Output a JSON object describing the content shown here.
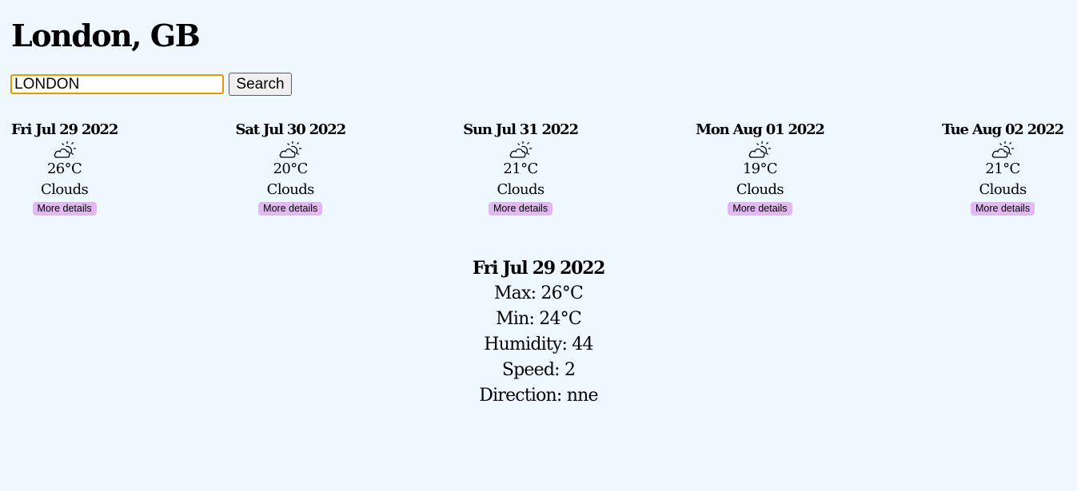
{
  "header": {
    "title": "London, GB"
  },
  "search": {
    "value": "LONDON",
    "button_label": "Search"
  },
  "forecast": [
    {
      "date": "Fri Jul 29 2022",
      "icon": "partly-cloudy-icon",
      "temp": "26°C",
      "description": "Clouds",
      "button_label": "More details"
    },
    {
      "date": "Sat Jul 30 2022",
      "icon": "partly-cloudy-icon",
      "temp": "20°C",
      "description": "Clouds",
      "button_label": "More details"
    },
    {
      "date": "Sun Jul 31 2022",
      "icon": "partly-cloudy-icon",
      "temp": "21°C",
      "description": "Clouds",
      "button_label": "More details"
    },
    {
      "date": "Mon Aug 01 2022",
      "icon": "partly-cloudy-icon",
      "temp": "19°C",
      "description": "Clouds",
      "button_label": "More details"
    },
    {
      "date": "Tue Aug 02 2022",
      "icon": "partly-cloudy-icon",
      "temp": "21°C",
      "description": "Clouds",
      "button_label": "More details"
    }
  ],
  "details": {
    "date": "Fri Jul 29 2022",
    "max": "Max: 26°C",
    "min": "Min: 24°C",
    "humidity": "Humidity: 44",
    "speed": "Speed: 2",
    "direction": "Direction: nne"
  },
  "colors": {
    "background": "#f0f8ff",
    "details_button": "#e2b8f0",
    "input_focus_border": "#e59a00"
  }
}
